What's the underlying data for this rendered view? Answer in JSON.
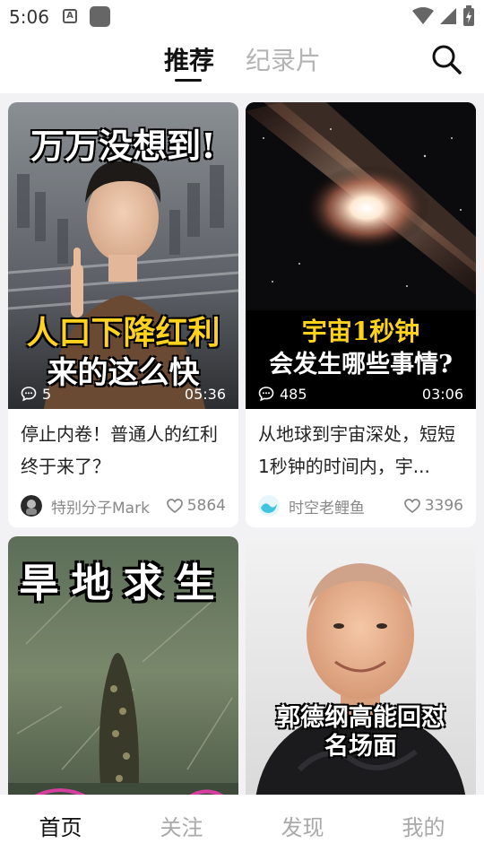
{
  "status_bar": {
    "time": "5:06"
  },
  "top_nav": {
    "tabs": [
      {
        "label": "推荐",
        "active": true
      },
      {
        "label": "纪录片",
        "active": false
      }
    ]
  },
  "feed": {
    "cards": [
      {
        "thumb_text": [
          "万万没想到!",
          "人口下降红利",
          "来的这么快"
        ],
        "comments": "5",
        "duration": "05:36",
        "title": "停止内卷！普通人的红利终于来了？",
        "author": "特别分子Mark",
        "likes": "5864"
      },
      {
        "thumb_text": [
          "宇宙1秒钟",
          "会发生哪些事情?"
        ],
        "comments": "485",
        "duration": "03:06",
        "title": "从地球到宇宙深处，短短1秒钟的时间内，宇...",
        "author": "时空老鲤鱼",
        "likes": "3396"
      },
      {
        "thumb_text": [
          "旱地求生"
        ]
      },
      {
        "thumb_text": [
          "郭德纲高能回怼",
          "名场面"
        ]
      }
    ]
  },
  "bottom_nav": {
    "items": [
      {
        "label": "首页",
        "active": true
      },
      {
        "label": "关注",
        "active": false
      },
      {
        "label": "发现",
        "active": false
      },
      {
        "label": "我的",
        "active": false
      }
    ]
  },
  "colors": {
    "accent_yellow": "#ffd21e",
    "text_primary": "#222222",
    "text_muted": "#888888"
  }
}
